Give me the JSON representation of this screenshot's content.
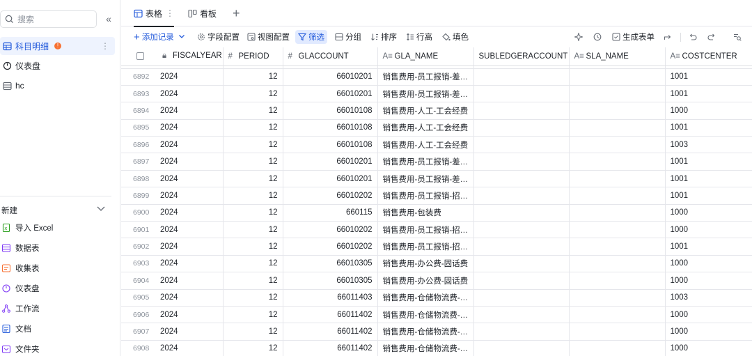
{
  "sidebar": {
    "search_placeholder": "搜索",
    "collapse_glyph": "«",
    "items": [
      {
        "label": "科目明细",
        "badge": "!",
        "active": true,
        "icon": "table-icon"
      },
      {
        "label": "仪表盘",
        "icon": "dashboard-icon"
      },
      {
        "label": "hc",
        "icon": "table-icon"
      }
    ],
    "new_section": {
      "title": "新建",
      "items": [
        {
          "label": "导入 Excel",
          "icon": "excel-icon"
        },
        {
          "label": "数据表",
          "icon": "datatable-icon"
        },
        {
          "label": "收集表",
          "icon": "form-icon"
        },
        {
          "label": "仪表盘",
          "icon": "dashboard-icon"
        },
        {
          "label": "工作流",
          "icon": "workflow-icon"
        },
        {
          "label": "文档",
          "icon": "doc-icon"
        },
        {
          "label": "文件夹",
          "icon": "folder-icon"
        }
      ]
    }
  },
  "tabs": [
    {
      "label": "表格",
      "icon": "table-icon",
      "active": true,
      "more": "⋮"
    },
    {
      "label": "看板",
      "icon": "kanban-icon"
    }
  ],
  "toolbar": {
    "add_record": "添加记录",
    "field_config": "字段配置",
    "view_config": "视图配置",
    "filter": "筛选",
    "group": "分组",
    "sort": "排序",
    "row_height": "行高",
    "fill": "填色",
    "generate_form": "生成表单"
  },
  "columns": [
    {
      "label": "",
      "type": "checkbox"
    },
    {
      "label": "FISCALYEAR",
      "icon": "lock-icon"
    },
    {
      "label": "PERIOD",
      "icon": "number-icon"
    },
    {
      "label": "GLACCOUNT",
      "icon": "number-icon"
    },
    {
      "label": "GLA_NAME",
      "icon": "text-icon"
    },
    {
      "label": "SUBLEDGERACCOUNT",
      "icon": ""
    },
    {
      "label": "SLA_NAME",
      "icon": "text-icon"
    },
    {
      "label": "COSTCENTER",
      "icon": "text-icon"
    }
  ],
  "rows": [
    {
      "n": "6892",
      "year": "2024",
      "period": "12",
      "gl": "66010201",
      "name": "销售费用-员工报销-差旅...",
      "sub": "",
      "sla": "",
      "cc": "1001"
    },
    {
      "n": "6893",
      "year": "2024",
      "period": "12",
      "gl": "66010201",
      "name": "销售费用-员工报销-差旅...",
      "sub": "",
      "sla": "",
      "cc": "1001"
    },
    {
      "n": "6894",
      "year": "2024",
      "period": "12",
      "gl": "66010108",
      "name": "销售费用-人工-工会经费",
      "sub": "",
      "sla": "",
      "cc": "1000"
    },
    {
      "n": "6895",
      "year": "2024",
      "period": "12",
      "gl": "66010108",
      "name": "销售费用-人工-工会经费",
      "sub": "",
      "sla": "",
      "cc": "1001"
    },
    {
      "n": "6896",
      "year": "2024",
      "period": "12",
      "gl": "66010108",
      "name": "销售费用-人工-工会经费",
      "sub": "",
      "sla": "",
      "cc": "1003"
    },
    {
      "n": "6897",
      "year": "2024",
      "period": "12",
      "gl": "66010201",
      "name": "销售费用-员工报销-差旅...",
      "sub": "",
      "sla": "",
      "cc": "1001"
    },
    {
      "n": "6898",
      "year": "2024",
      "period": "12",
      "gl": "66010201",
      "name": "销售费用-员工报销-差旅...",
      "sub": "",
      "sla": "",
      "cc": "1001"
    },
    {
      "n": "6899",
      "year": "2024",
      "period": "12",
      "gl": "66010202",
      "name": "销售费用-员工报销-招待...",
      "sub": "",
      "sla": "",
      "cc": "1001"
    },
    {
      "n": "6900",
      "year": "2024",
      "period": "12",
      "gl": "660115",
      "name": "销售费用-包装费",
      "sub": "",
      "sla": "",
      "cc": "1000"
    },
    {
      "n": "6901",
      "year": "2024",
      "period": "12",
      "gl": "66010202",
      "name": "销售费用-员工报销-招待...",
      "sub": "",
      "sla": "",
      "cc": "1000"
    },
    {
      "n": "6902",
      "year": "2024",
      "period": "12",
      "gl": "66010202",
      "name": "销售费用-员工报销-招待...",
      "sub": "",
      "sla": "",
      "cc": "1001"
    },
    {
      "n": "6903",
      "year": "2024",
      "period": "12",
      "gl": "66010305",
      "name": "销售费用-办公费-固话费",
      "sub": "",
      "sla": "",
      "cc": "1000"
    },
    {
      "n": "6904",
      "year": "2024",
      "period": "12",
      "gl": "66010305",
      "name": "销售费用-办公费-固话费",
      "sub": "",
      "sla": "",
      "cc": "1000"
    },
    {
      "n": "6905",
      "year": "2024",
      "period": "12",
      "gl": "66011403",
      "name": "销售费用-仓储物流费-其...",
      "sub": "",
      "sla": "",
      "cc": "1003"
    },
    {
      "n": "6906",
      "year": "2024",
      "period": "12",
      "gl": "66011402",
      "name": "销售费用-仓储物流费-出...",
      "sub": "",
      "sla": "",
      "cc": "1000"
    },
    {
      "n": "6907",
      "year": "2024",
      "period": "12",
      "gl": "66011402",
      "name": "销售费用-仓储物流费-出...",
      "sub": "",
      "sla": "",
      "cc": "1000"
    },
    {
      "n": "6908",
      "year": "2024",
      "period": "12",
      "gl": "66011402",
      "name": "销售费用-仓储物流费-出...",
      "sub": "",
      "sla": "",
      "cc": "1000"
    }
  ],
  "colors": {
    "accent": "#245bdb",
    "badge": "#f77234",
    "active_bg": "#eef3fe",
    "filter_bg": "#e1eaff"
  }
}
